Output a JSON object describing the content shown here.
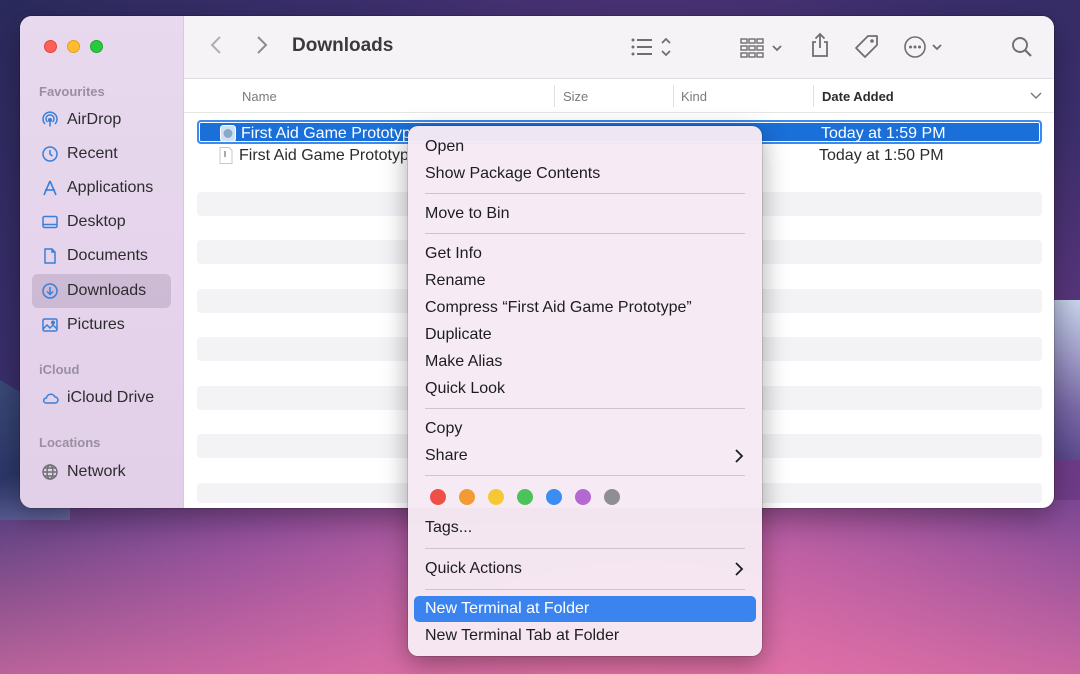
{
  "window": {
    "title": "Downloads"
  },
  "sidebar": {
    "sections": [
      {
        "label": "Favourites"
      },
      {
        "label": "iCloud"
      },
      {
        "label": "Locations"
      }
    ],
    "items": [
      {
        "label": "AirDrop",
        "icon": "airdrop-icon"
      },
      {
        "label": "Recent",
        "icon": "clock-icon"
      },
      {
        "label": "Applications",
        "icon": "applications-icon"
      },
      {
        "label": "Desktop",
        "icon": "desktop-icon"
      },
      {
        "label": "Documents",
        "icon": "document-icon"
      },
      {
        "label": "Downloads",
        "icon": "download-icon",
        "active": true
      },
      {
        "label": "Pictures",
        "icon": "photo-icon"
      },
      {
        "label": "iCloud Drive",
        "icon": "cloud-icon"
      },
      {
        "label": "Network",
        "icon": "globe-icon"
      }
    ]
  },
  "columns": {
    "name": "Name",
    "size": "Size",
    "kind": "Kind",
    "date_added": "Date Added"
  },
  "files": [
    {
      "name": "First Aid Game Prototype",
      "date_added": "Today at 1:59 PM",
      "selected": true
    },
    {
      "name": "First Aid Game Prototype",
      "date_added": "Today at 1:50 PM",
      "selected": false
    }
  ],
  "context_menu": {
    "open": "Open",
    "show_package_contents": "Show Package Contents",
    "move_to_bin": "Move to Bin",
    "get_info": "Get Info",
    "rename": "Rename",
    "compress": "Compress “First Aid Game Prototype”",
    "duplicate": "Duplicate",
    "make_alias": "Make Alias",
    "quick_look": "Quick Look",
    "copy": "Copy",
    "share": "Share",
    "tags": "Tags...",
    "quick_actions": "Quick Actions",
    "new_terminal_at_folder": "New Terminal at Folder",
    "new_terminal_tab_at_folder": "New Terminal Tab at Folder",
    "tag_colors": [
      "#ee5048",
      "#f29a33",
      "#f6c834",
      "#4cc25a",
      "#3a8ef2",
      "#b368d2",
      "#8e8e93"
    ]
  }
}
